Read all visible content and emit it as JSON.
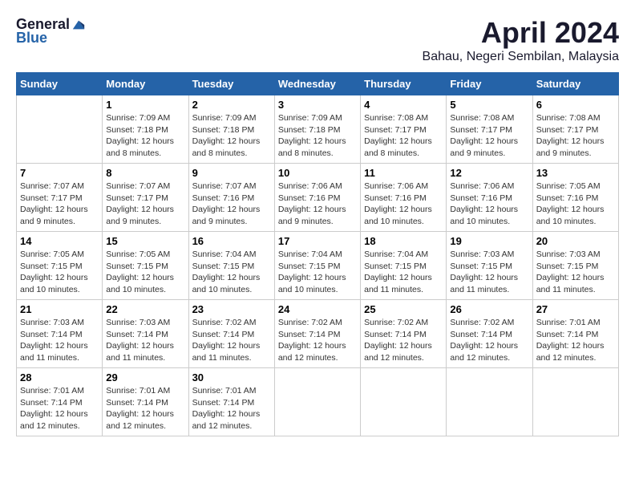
{
  "header": {
    "logo_general": "General",
    "logo_blue": "Blue",
    "month": "April 2024",
    "location": "Bahau, Negeri Sembilan, Malaysia"
  },
  "days_of_week": [
    "Sunday",
    "Monday",
    "Tuesday",
    "Wednesday",
    "Thursday",
    "Friday",
    "Saturday"
  ],
  "weeks": [
    [
      {
        "day": "",
        "sunrise": "",
        "sunset": "",
        "daylight": ""
      },
      {
        "day": "1",
        "sunrise": "7:09 AM",
        "sunset": "7:18 PM",
        "daylight": "12 hours and 8 minutes."
      },
      {
        "day": "2",
        "sunrise": "7:09 AM",
        "sunset": "7:18 PM",
        "daylight": "12 hours and 8 minutes."
      },
      {
        "day": "3",
        "sunrise": "7:09 AM",
        "sunset": "7:18 PM",
        "daylight": "12 hours and 8 minutes."
      },
      {
        "day": "4",
        "sunrise": "7:08 AM",
        "sunset": "7:17 PM",
        "daylight": "12 hours and 8 minutes."
      },
      {
        "day": "5",
        "sunrise": "7:08 AM",
        "sunset": "7:17 PM",
        "daylight": "12 hours and 9 minutes."
      },
      {
        "day": "6",
        "sunrise": "7:08 AM",
        "sunset": "7:17 PM",
        "daylight": "12 hours and 9 minutes."
      }
    ],
    [
      {
        "day": "7",
        "sunrise": "7:07 AM",
        "sunset": "7:17 PM",
        "daylight": "12 hours and 9 minutes."
      },
      {
        "day": "8",
        "sunrise": "7:07 AM",
        "sunset": "7:17 PM",
        "daylight": "12 hours and 9 minutes."
      },
      {
        "day": "9",
        "sunrise": "7:07 AM",
        "sunset": "7:16 PM",
        "daylight": "12 hours and 9 minutes."
      },
      {
        "day": "10",
        "sunrise": "7:06 AM",
        "sunset": "7:16 PM",
        "daylight": "12 hours and 9 minutes."
      },
      {
        "day": "11",
        "sunrise": "7:06 AM",
        "sunset": "7:16 PM",
        "daylight": "12 hours and 10 minutes."
      },
      {
        "day": "12",
        "sunrise": "7:06 AM",
        "sunset": "7:16 PM",
        "daylight": "12 hours and 10 minutes."
      },
      {
        "day": "13",
        "sunrise": "7:05 AM",
        "sunset": "7:16 PM",
        "daylight": "12 hours and 10 minutes."
      }
    ],
    [
      {
        "day": "14",
        "sunrise": "7:05 AM",
        "sunset": "7:15 PM",
        "daylight": "12 hours and 10 minutes."
      },
      {
        "day": "15",
        "sunrise": "7:05 AM",
        "sunset": "7:15 PM",
        "daylight": "12 hours and 10 minutes."
      },
      {
        "day": "16",
        "sunrise": "7:04 AM",
        "sunset": "7:15 PM",
        "daylight": "12 hours and 10 minutes."
      },
      {
        "day": "17",
        "sunrise": "7:04 AM",
        "sunset": "7:15 PM",
        "daylight": "12 hours and 10 minutes."
      },
      {
        "day": "18",
        "sunrise": "7:04 AM",
        "sunset": "7:15 PM",
        "daylight": "12 hours and 11 minutes."
      },
      {
        "day": "19",
        "sunrise": "7:03 AM",
        "sunset": "7:15 PM",
        "daylight": "12 hours and 11 minutes."
      },
      {
        "day": "20",
        "sunrise": "7:03 AM",
        "sunset": "7:15 PM",
        "daylight": "12 hours and 11 minutes."
      }
    ],
    [
      {
        "day": "21",
        "sunrise": "7:03 AM",
        "sunset": "7:14 PM",
        "daylight": "12 hours and 11 minutes."
      },
      {
        "day": "22",
        "sunrise": "7:03 AM",
        "sunset": "7:14 PM",
        "daylight": "12 hours and 11 minutes."
      },
      {
        "day": "23",
        "sunrise": "7:02 AM",
        "sunset": "7:14 PM",
        "daylight": "12 hours and 11 minutes."
      },
      {
        "day": "24",
        "sunrise": "7:02 AM",
        "sunset": "7:14 PM",
        "daylight": "12 hours and 12 minutes."
      },
      {
        "day": "25",
        "sunrise": "7:02 AM",
        "sunset": "7:14 PM",
        "daylight": "12 hours and 12 minutes."
      },
      {
        "day": "26",
        "sunrise": "7:02 AM",
        "sunset": "7:14 PM",
        "daylight": "12 hours and 12 minutes."
      },
      {
        "day": "27",
        "sunrise": "7:01 AM",
        "sunset": "7:14 PM",
        "daylight": "12 hours and 12 minutes."
      }
    ],
    [
      {
        "day": "28",
        "sunrise": "7:01 AM",
        "sunset": "7:14 PM",
        "daylight": "12 hours and 12 minutes."
      },
      {
        "day": "29",
        "sunrise": "7:01 AM",
        "sunset": "7:14 PM",
        "daylight": "12 hours and 12 minutes."
      },
      {
        "day": "30",
        "sunrise": "7:01 AM",
        "sunset": "7:14 PM",
        "daylight": "12 hours and 12 minutes."
      },
      {
        "day": "",
        "sunrise": "",
        "sunset": "",
        "daylight": ""
      },
      {
        "day": "",
        "sunrise": "",
        "sunset": "",
        "daylight": ""
      },
      {
        "day": "",
        "sunrise": "",
        "sunset": "",
        "daylight": ""
      },
      {
        "day": "",
        "sunrise": "",
        "sunset": "",
        "daylight": ""
      }
    ]
  ],
  "labels": {
    "sunrise": "Sunrise:",
    "sunset": "Sunset:",
    "daylight": "Daylight:"
  }
}
